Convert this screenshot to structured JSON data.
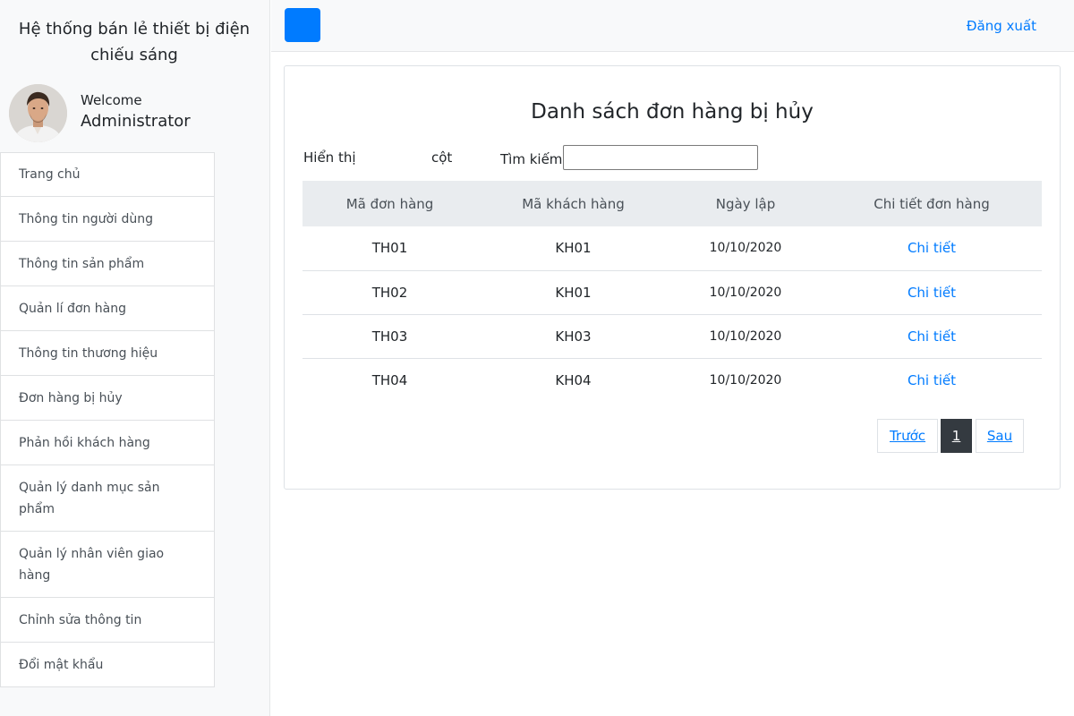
{
  "brand": {
    "title": "Hệ thống bán lẻ thiết bị điện chiếu sáng"
  },
  "user": {
    "welcome": "Welcome",
    "name": "Administrator"
  },
  "sidebar": {
    "items": [
      {
        "label": "Trang chủ"
      },
      {
        "label": "Thông tin người dùng"
      },
      {
        "label": "Thông tin sản phẩm"
      },
      {
        "label": "Quản lí đơn hàng"
      },
      {
        "label": "Thông tin thương hiệu"
      },
      {
        "label": "Đơn hàng bị hủy"
      },
      {
        "label": "Phản hồi khách hàng"
      },
      {
        "label": "Quản lý danh mục sản phẩm"
      },
      {
        "label": "Quản lý nhân viên giao hàng"
      },
      {
        "label": "Chỉnh sửa thông tin"
      },
      {
        "label": "Đổi mật khẩu"
      }
    ]
  },
  "topbar": {
    "logout": "Đăng xuất",
    "accent": "#007bff"
  },
  "main": {
    "title": "Danh sách đơn hàng bị hủy",
    "show_label": "Hiển thị",
    "col_label": "cột",
    "search_label": "Tìm kiếm",
    "search_value": "",
    "table": {
      "headers": [
        "Mã đơn hàng",
        "Mã khách hàng",
        "Ngày lập",
        "Chi tiết đơn hàng"
      ],
      "rows": [
        {
          "order": "TH01",
          "customer": "KH01",
          "date": "10/10/2020",
          "detail": "Chi tiết"
        },
        {
          "order": "TH02",
          "customer": "KH01",
          "date": "10/10/2020",
          "detail": "Chi tiết"
        },
        {
          "order": "TH03",
          "customer": "KH03",
          "date": "10/10/2020",
          "detail": "Chi tiết"
        },
        {
          "order": "TH04",
          "customer": "KH04",
          "date": "10/10/2020",
          "detail": "Chi tiết"
        }
      ]
    },
    "pagination": {
      "prev": "Trước",
      "current": "1",
      "next": "Sau"
    }
  }
}
